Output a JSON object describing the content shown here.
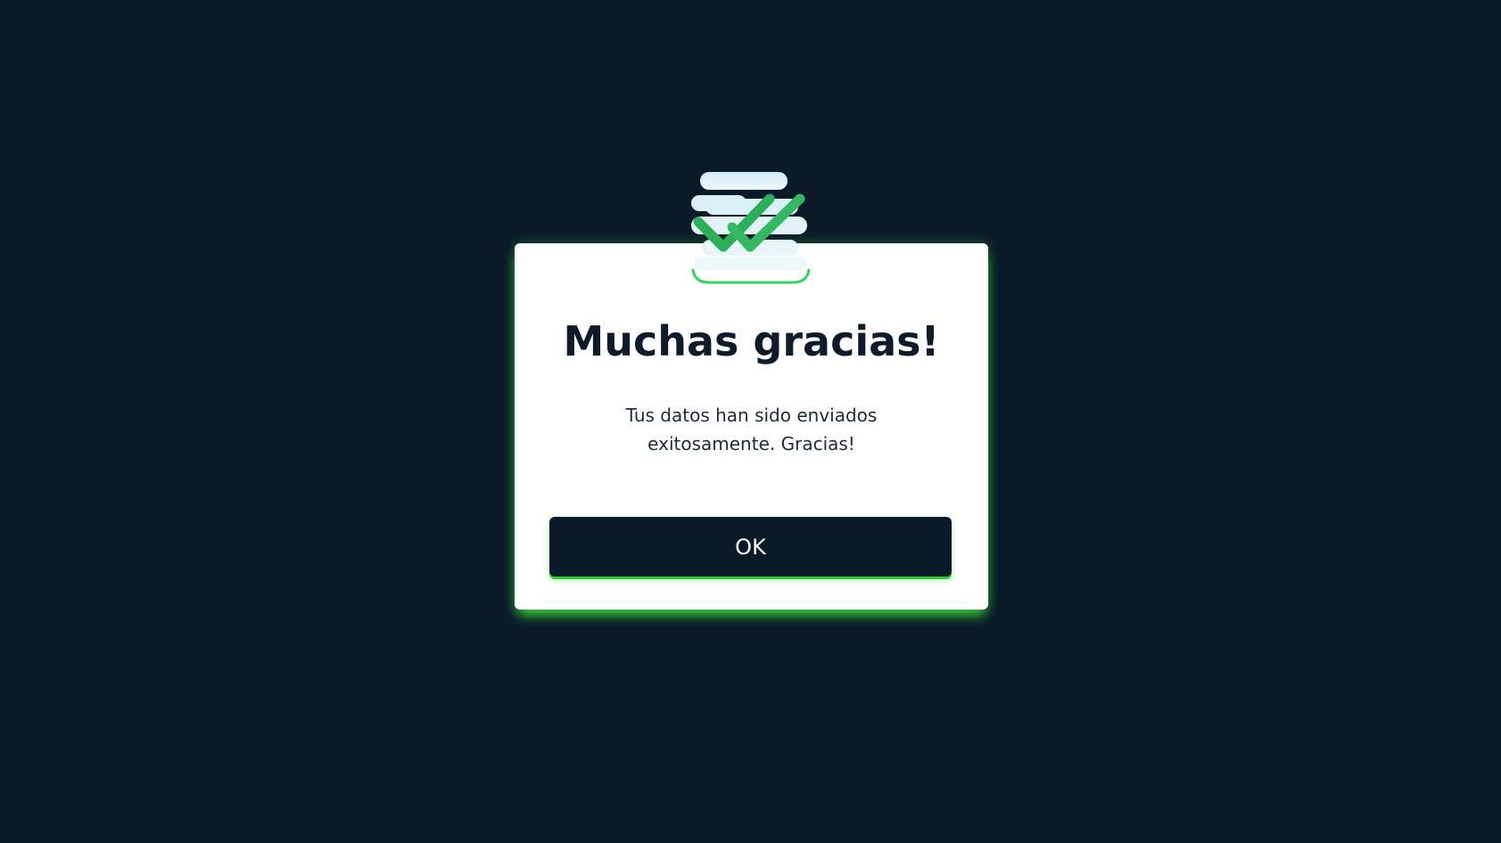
{
  "dialog": {
    "title": "Muchas gracias!",
    "message": "Tus datos han sido enviados exitosamente. Gracias!",
    "ok_label": "OK",
    "icon": "double-check-icon"
  },
  "colors": {
    "background": "#0b1a29",
    "card": "#ffffff",
    "accent_glow": "#2bd12b",
    "check_green": "#2fae5a",
    "button": "#0b1a29"
  }
}
